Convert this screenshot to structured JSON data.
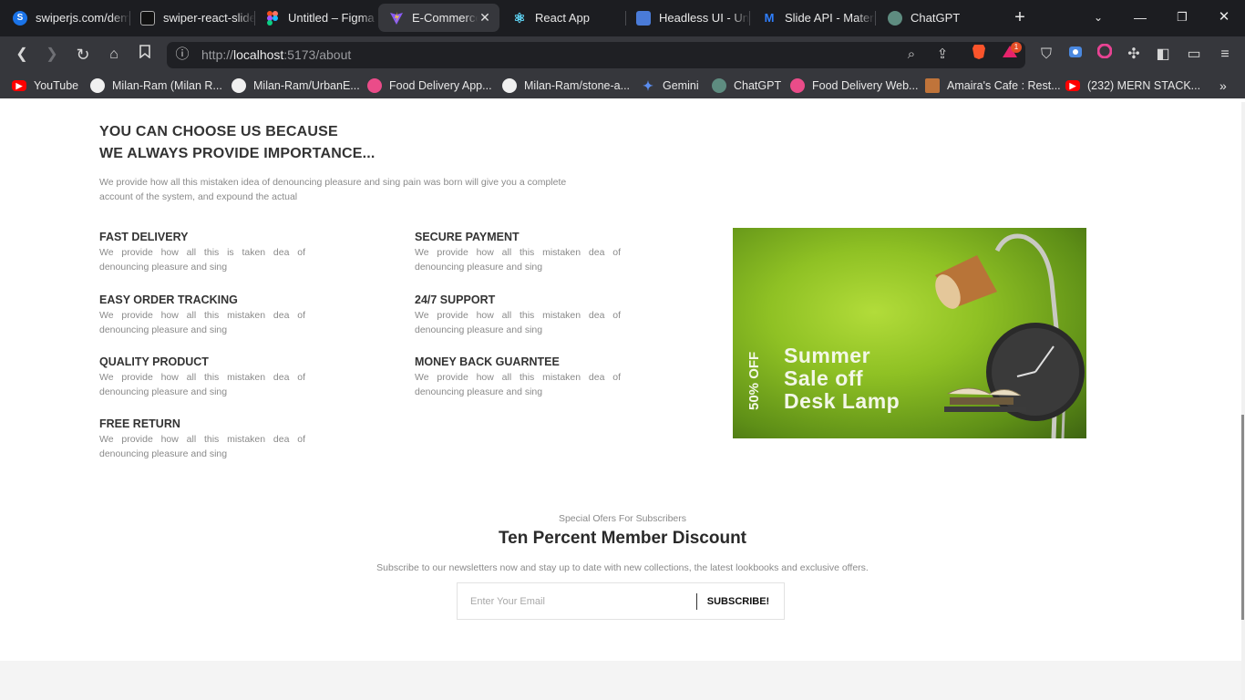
{
  "browser": {
    "tabs": [
      {
        "title": "swiperjs.com/demos",
        "favicon": "swiper-icon",
        "color": "#1a73e8"
      },
      {
        "title": "swiper-react-slider",
        "favicon": "code-icon",
        "color": "#222222"
      },
      {
        "title": "Untitled – Figma",
        "favicon": "figma-icon",
        "color": "#f24e1e"
      },
      {
        "title": "E-Commerce",
        "favicon": "vite-icon",
        "color": "#8b5cf6",
        "active": true
      },
      {
        "title": "React App",
        "favicon": "react-icon",
        "color": "#61dafb"
      },
      {
        "title": "Headless UI - Unstyled",
        "favicon": "headlessui-icon",
        "color": "#66e3ff"
      },
      {
        "title": "Slide API - Material UI",
        "favicon": "mui-icon",
        "color": "#007fff"
      },
      {
        "title": "ChatGPT",
        "favicon": "chatgpt-icon",
        "color": "#74aa9c"
      }
    ],
    "url_prefix": "http://",
    "url_host": "localhost",
    "url_rest": ":5173/about",
    "brave_badge": "1",
    "bookmarks": [
      {
        "label": "YouTube",
        "icon": "youtube-icon",
        "color": "#ff0000"
      },
      {
        "label": "Milan-Ram (Milan R...",
        "icon": "github-icon",
        "color": "#f0f0f0"
      },
      {
        "label": "Milan-Ram/UrbanE...",
        "icon": "github-icon",
        "color": "#f0f0f0"
      },
      {
        "label": "Food Delivery App...",
        "icon": "dribbble-icon",
        "color": "#ea4c89"
      },
      {
        "label": "Milan-Ram/stone-a...",
        "icon": "github-icon",
        "color": "#f0f0f0"
      },
      {
        "label": "Gemini",
        "icon": "gemini-icon",
        "color": "#5b8def"
      },
      {
        "label": "ChatGPT",
        "icon": "chatgpt-icon",
        "color": "#74aa9c"
      },
      {
        "label": "Food Delivery Web...",
        "icon": "dribbble-icon",
        "color": "#ea4c89"
      },
      {
        "label": "Amaira's Cafe : Rest...",
        "icon": "cafe-icon",
        "color": "#c0743a"
      },
      {
        "label": "(232) MERN STACK...",
        "icon": "youtube-icon",
        "color": "#ff0000"
      }
    ]
  },
  "about": {
    "heading_line1": "YOU CAN CHOOSE US BECAUSE",
    "heading_line2": "WE ALWAYS PROVIDE IMPORTANCE...",
    "intro": "We provide how all this mistaken idea of denouncing pleasure and sing pain was born will give you a complete account of the system, and expound the actual",
    "features": [
      {
        "title": "FAST DELIVERY",
        "text": "We provide how all this is taken dea of denouncing pleasure and sing"
      },
      {
        "title": "SECURE PAYMENT",
        "text": "We provide how all this mistaken dea of denouncing pleasure and sing"
      },
      {
        "title": "EASY ORDER TRACKING",
        "text": "We provide how all this mistaken dea of denouncing pleasure and sing"
      },
      {
        "title": "24/7 SUPPORT",
        "text": "We provide how all this mistaken dea of denouncing pleasure and sing"
      },
      {
        "title": "QUALITY PRODUCT",
        "text": "We provide how all this mistaken dea of denouncing pleasure and sing"
      },
      {
        "title": "MONEY BACK GUARNTEE",
        "text": "We provide how all this mistaken dea of denouncing pleasure and sing"
      },
      {
        "title": "FREE RETURN",
        "text": "We provide how all this mistaken dea of denouncing pleasure and sing"
      }
    ],
    "promo": {
      "line1": "Summer",
      "line2": "Sale off",
      "line3": "Desk Lamp",
      "discount": "50% OFF"
    }
  },
  "subscribe": {
    "kicker": "Special Ofers For Subscribers",
    "title": "Ten Percent Member Discount",
    "description": "Subscribe to our newsletters now and stay up to date with new collections, the latest lookbooks and exclusive offers.",
    "placeholder": "Enter Your Email",
    "button": "SUBSCRIBE!"
  }
}
